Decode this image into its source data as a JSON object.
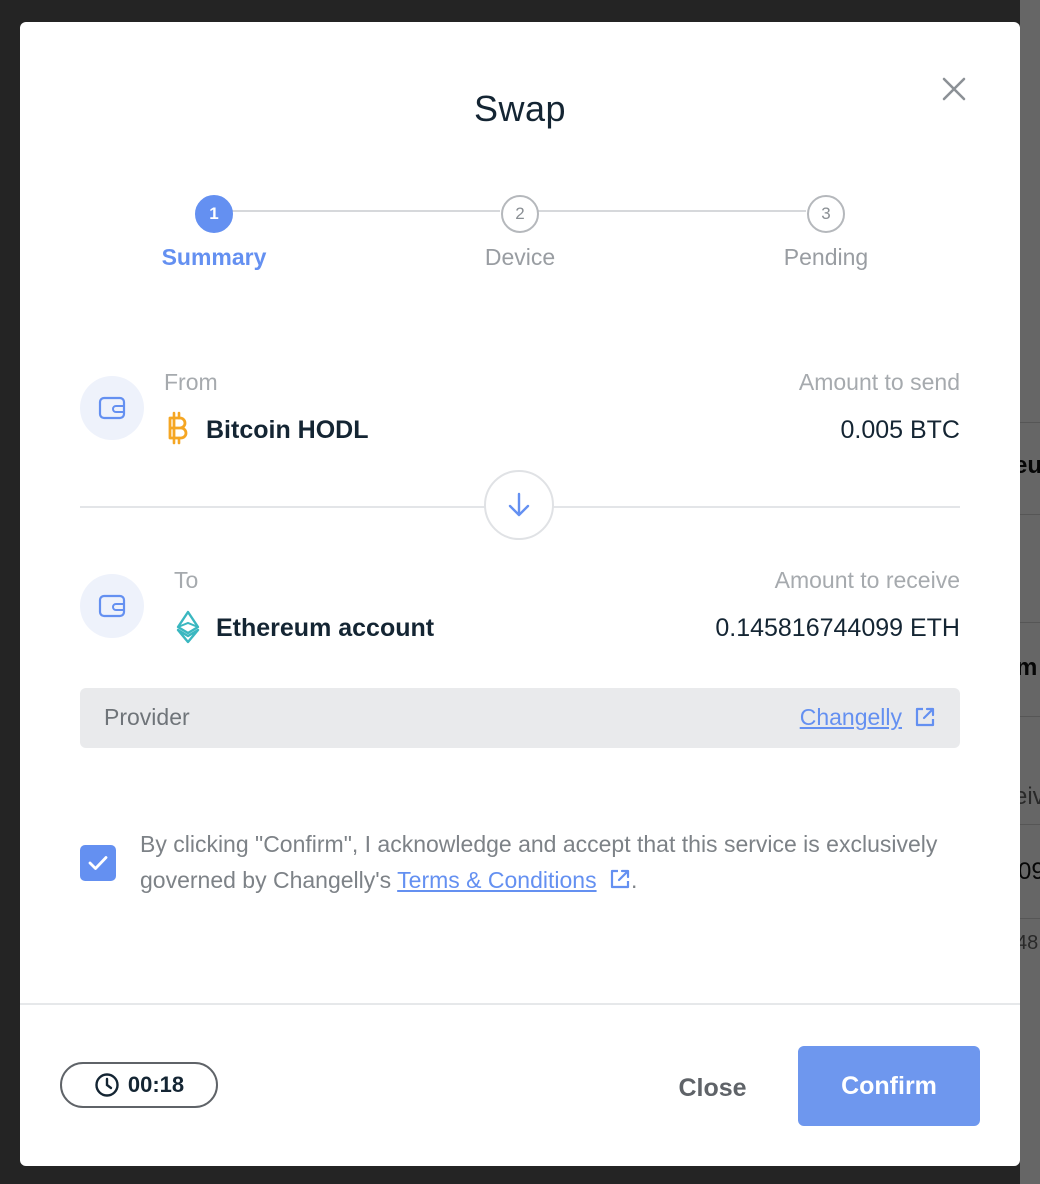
{
  "modal": {
    "title": "Swap"
  },
  "stepper": {
    "steps": [
      {
        "number": "1",
        "label": "Summary",
        "state": "active"
      },
      {
        "number": "2",
        "label": "Device",
        "state": "pending"
      },
      {
        "number": "3",
        "label": "Pending",
        "state": "pending"
      }
    ]
  },
  "from": {
    "label": "From",
    "account": "Bitcoin HODL",
    "currency_icon": "bitcoin-icon",
    "amount_label": "Amount to send",
    "amount": "0.005 BTC"
  },
  "to": {
    "label": "To",
    "account": "Ethereum account",
    "currency_icon": "ethereum-icon",
    "amount_label": "Amount to receive",
    "amount": "0.145816744099 ETH"
  },
  "provider": {
    "label": "Provider",
    "name": "Changelly"
  },
  "consent": {
    "checked": true,
    "text_before": "By clicking \"Confirm\", I acknowledge and accept that this service is exclusively governed by Changelly's",
    "link_text": "Terms & Conditions",
    "text_after": "."
  },
  "footer": {
    "timer": "00:18",
    "close_label": "Close",
    "confirm_label": "Confirm"
  },
  "colors": {
    "accent": "#6490f1",
    "bitcoin": "#f5a623",
    "ethereum": "#3ab7c0"
  }
}
